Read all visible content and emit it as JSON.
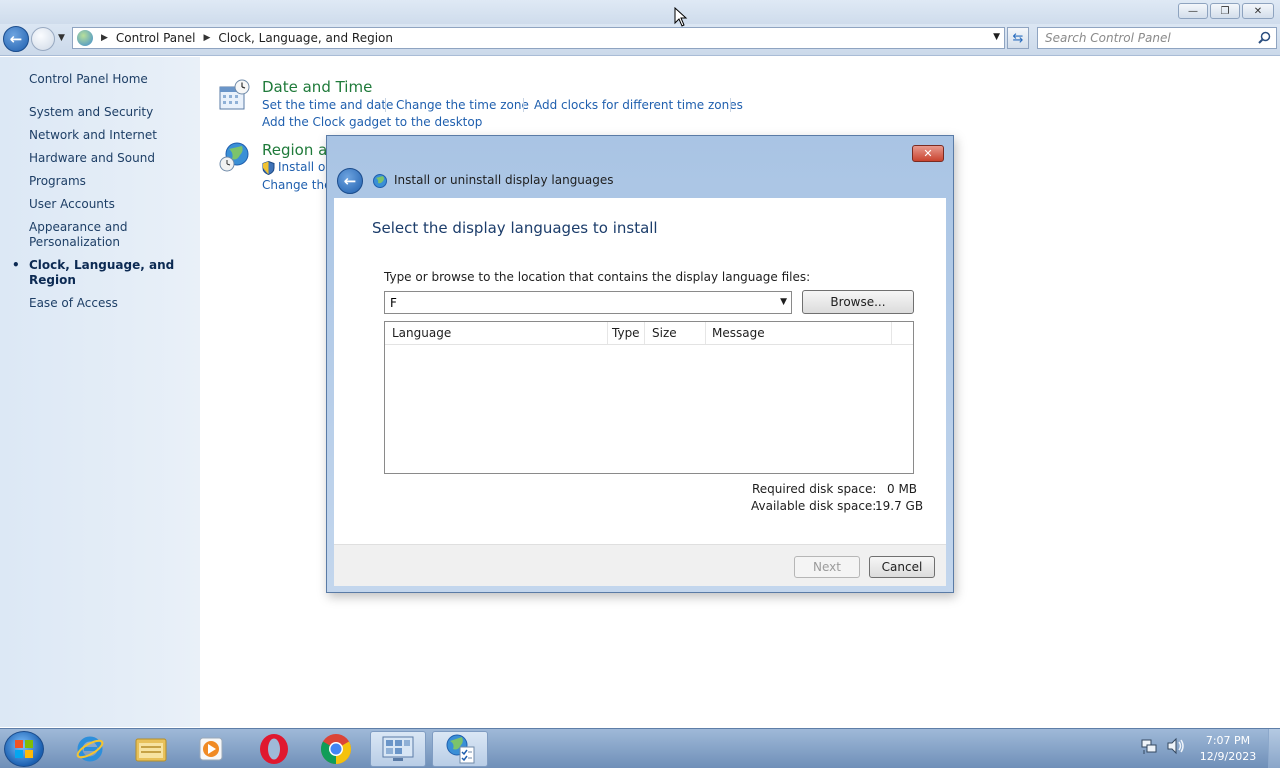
{
  "window": {
    "minimize_glyph": "—",
    "maximize_glyph": "❐",
    "close_glyph": "✕"
  },
  "address_bar": {
    "breadcrumbs": [
      "Control Panel",
      "Clock, Language, and Region"
    ],
    "search_placeholder": "Search Control Panel"
  },
  "sidebar": {
    "home": "Control Panel Home",
    "items": [
      {
        "label": "System and Security"
      },
      {
        "label": "Network and Internet"
      },
      {
        "label": "Hardware and Sound"
      },
      {
        "label": "Programs"
      },
      {
        "label": "User Accounts"
      },
      {
        "label": "Appearance and Personalization"
      },
      {
        "label": "Clock, Language, and Region",
        "active": true
      },
      {
        "label": "Ease of Access"
      }
    ]
  },
  "main": {
    "date_time": {
      "title": "Date and Time",
      "links": [
        "Set the time and date",
        "Change the time zone",
        "Add clocks for different time zones",
        "Add the Clock gadget to the desktop"
      ]
    },
    "region": {
      "title": "Region ar",
      "links": [
        "Install or",
        "Change the"
      ]
    }
  },
  "dialog": {
    "title": "Install or uninstall display languages",
    "heading": "Select the display languages to install",
    "path_label": "Type or browse to the location that contains the display language files:",
    "path_value": "F",
    "browse_label": "Browse...",
    "columns": [
      "Language",
      "Type",
      "Size",
      "Message"
    ],
    "rows": [],
    "required_label": "Required disk space:",
    "required_value": "0 MB",
    "available_label": "Available disk space:",
    "available_value": "19.7 GB",
    "next_label": "Next",
    "cancel_label": "Cancel",
    "close_glyph": "✕"
  },
  "taskbar": {
    "time": "7:07 PM",
    "date": "12/9/2023",
    "apps": [
      "internet-explorer",
      "file-explorer",
      "media-player",
      "opera",
      "chrome",
      "control-panel",
      "language-installer"
    ]
  },
  "colors": {
    "accent_link": "#1f5fae",
    "category_title": "#1f7a3a",
    "sidebar_bg": "#dce8f5"
  }
}
